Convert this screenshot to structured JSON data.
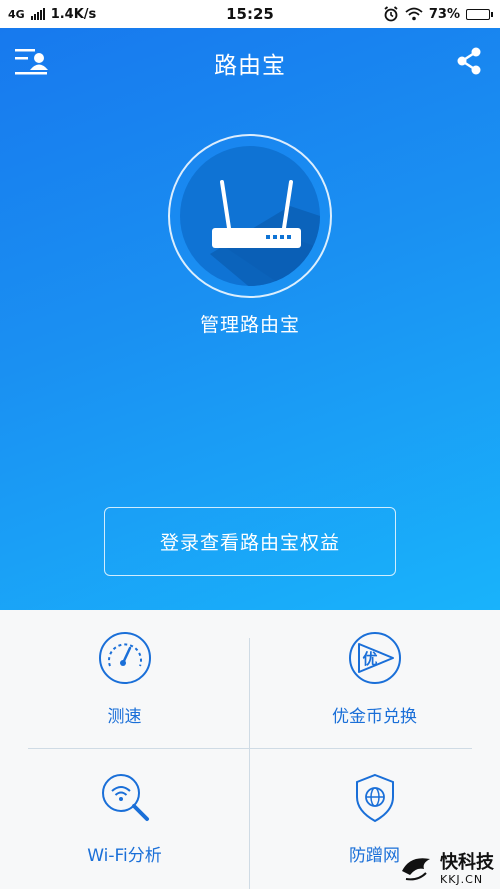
{
  "status_bar": {
    "network": "4G",
    "speed": "1.4K/s",
    "time": "15:25",
    "battery": "73%",
    "battery_level": 0.73
  },
  "header": {
    "title": "路由宝",
    "menu_icon": "user-list-icon",
    "share_icon": "share-icon"
  },
  "hero": {
    "router_icon": "router-icon",
    "manage_label": "管理路由宝",
    "login_button": "登录查看路由宝权益"
  },
  "features": [
    {
      "label": "测速",
      "icon": "speedometer-icon"
    },
    {
      "label": "优金币兑换",
      "icon": "coin-exchange-icon",
      "badge": "优"
    },
    {
      "label": "Wi-Fi分析",
      "icon": "wifi-search-icon"
    },
    {
      "label": "防蹭网",
      "icon": "shield-globe-icon"
    }
  ],
  "watermark": {
    "main": "快科技",
    "sub": "KKJ.CN"
  },
  "colors": {
    "hero_start": "#1779ee",
    "hero_end": "#19b3fb",
    "accent": "#1a6fd8",
    "grid_bg": "#f7f8f9"
  }
}
